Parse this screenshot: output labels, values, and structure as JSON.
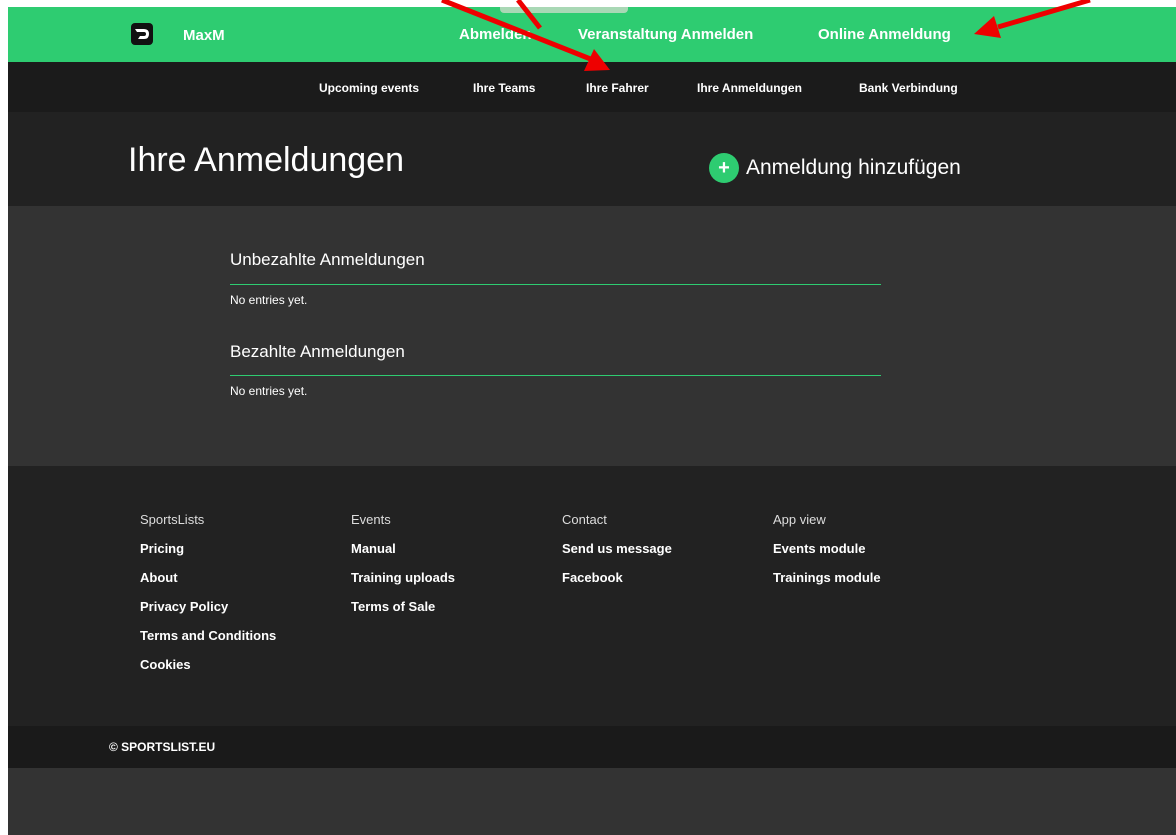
{
  "topbar": {
    "brand": "MaxM",
    "nav": [
      "Abmelden",
      "Veranstaltung Anmelden",
      "Online Anmeldung"
    ]
  },
  "subnav": [
    "Upcoming events",
    "Ihre Teams",
    "Ihre Fahrer",
    "Ihre Anmeldungen",
    "Bank Verbindung"
  ],
  "header": {
    "title": "Ihre Anmeldungen",
    "add_label": "Anmeldung hinzufügen",
    "add_icon": "plus-circle-icon"
  },
  "sections": [
    {
      "title": "Unbezahlte Anmeldungen",
      "empty": "No entries yet."
    },
    {
      "title": "Bezahlte Anmeldungen",
      "empty": "No entries yet."
    }
  ],
  "footer": {
    "columns": [
      {
        "heading": "SportsLists",
        "links": [
          "Pricing",
          "About",
          "Privacy Policy",
          "Terms and Conditions",
          "Cookies"
        ]
      },
      {
        "heading": "Events",
        "links": [
          "Manual",
          "Training uploads",
          "Terms of Sale"
        ]
      },
      {
        "heading": "Contact",
        "links": [
          "Send us message",
          "Facebook"
        ]
      },
      {
        "heading": "App view",
        "links": [
          "Events module",
          "Trainings module"
        ]
      }
    ],
    "copyright": "© SPORTSLIST.EU"
  },
  "colors": {
    "accent": "#2ecc71",
    "annotation": "#ee0000"
  }
}
